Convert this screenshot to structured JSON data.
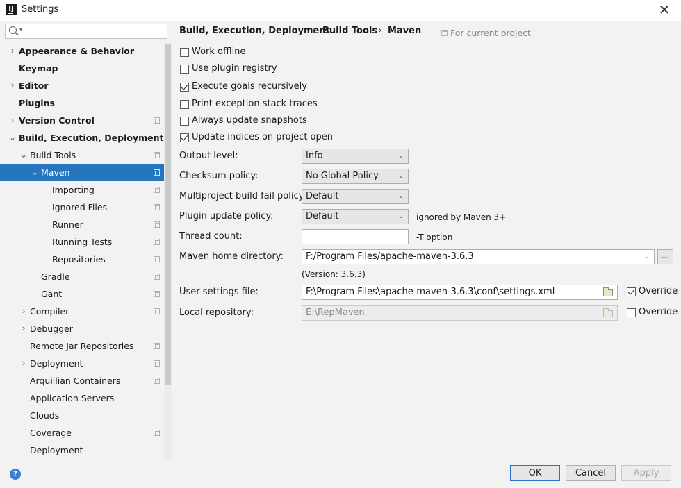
{
  "window": {
    "title": "Settings",
    "app_icon": "IJ"
  },
  "search": {
    "value": "",
    "placeholder": ""
  },
  "tree": [
    {
      "label": "Appearance & Behavior",
      "bold": true,
      "arrow": "›",
      "depth": 0,
      "shared": false
    },
    {
      "label": "Keymap",
      "bold": true,
      "arrow": "",
      "depth": 0,
      "shared": false
    },
    {
      "label": "Editor",
      "bold": true,
      "arrow": "›",
      "depth": 0,
      "shared": false
    },
    {
      "label": "Plugins",
      "bold": true,
      "arrow": "",
      "depth": 0,
      "shared": false
    },
    {
      "label": "Version Control",
      "bold": true,
      "arrow": "›",
      "depth": 0,
      "shared": true
    },
    {
      "label": "Build, Execution, Deployment",
      "bold": true,
      "arrow": "⌄",
      "depth": 0,
      "shared": false
    },
    {
      "label": "Build Tools",
      "bold": false,
      "arrow": "⌄",
      "depth": 1,
      "shared": true
    },
    {
      "label": "Maven",
      "bold": false,
      "arrow": "⌄",
      "depth": 2,
      "shared": true,
      "selected": true
    },
    {
      "label": "Importing",
      "bold": false,
      "arrow": "",
      "depth": 3,
      "shared": true
    },
    {
      "label": "Ignored Files",
      "bold": false,
      "arrow": "",
      "depth": 3,
      "shared": true
    },
    {
      "label": "Runner",
      "bold": false,
      "arrow": "",
      "depth": 3,
      "shared": true
    },
    {
      "label": "Running Tests",
      "bold": false,
      "arrow": "",
      "depth": 3,
      "shared": true
    },
    {
      "label": "Repositories",
      "bold": false,
      "arrow": "",
      "depth": 3,
      "shared": true
    },
    {
      "label": "Gradle",
      "bold": false,
      "arrow": "",
      "depth": 2,
      "shared": true
    },
    {
      "label": "Gant",
      "bold": false,
      "arrow": "",
      "depth": 2,
      "shared": true
    },
    {
      "label": "Compiler",
      "bold": false,
      "arrow": "›",
      "depth": 1,
      "shared": true
    },
    {
      "label": "Debugger",
      "bold": false,
      "arrow": "›",
      "depth": 1,
      "shared": false
    },
    {
      "label": "Remote Jar Repositories",
      "bold": false,
      "arrow": "",
      "depth": 1,
      "shared": true
    },
    {
      "label": "Deployment",
      "bold": false,
      "arrow": "›",
      "depth": 1,
      "shared": true
    },
    {
      "label": "Arquillian Containers",
      "bold": false,
      "arrow": "",
      "depth": 1,
      "shared": true
    },
    {
      "label": "Application Servers",
      "bold": false,
      "arrow": "",
      "depth": 1,
      "shared": false
    },
    {
      "label": "Clouds",
      "bold": false,
      "arrow": "",
      "depth": 1,
      "shared": false
    },
    {
      "label": "Coverage",
      "bold": false,
      "arrow": "",
      "depth": 1,
      "shared": true
    },
    {
      "label": "Deployment",
      "bold": false,
      "arrow": "",
      "depth": 1,
      "shared": false
    }
  ],
  "breadcrumb": {
    "parts": [
      "Build, Execution, Deployment",
      "Build Tools",
      "Maven"
    ],
    "separator": "›",
    "scope": "For current project"
  },
  "options": [
    {
      "label": "Work offline",
      "checked": false
    },
    {
      "label": "Use plugin registry",
      "checked": false
    },
    {
      "label": "Execute goals recursively",
      "checked": true
    },
    {
      "label": "Print exception stack traces",
      "checked": false
    },
    {
      "label": "Always update snapshots",
      "checked": false
    },
    {
      "label": "Update indices on project open",
      "checked": true
    }
  ],
  "fields": {
    "output_level": {
      "label": "Output level:",
      "value": "Info"
    },
    "checksum_policy": {
      "label": "Checksum policy:",
      "value": "No Global Policy"
    },
    "multiproject_fail": {
      "label": "Multiproject build fail policy:",
      "value": "Default"
    },
    "plugin_update": {
      "label": "Plugin update policy:",
      "value": "Default",
      "note": "ignored by Maven 3+"
    },
    "thread_count": {
      "label": "Thread count:",
      "value": "",
      "note": "-T option"
    },
    "maven_home": {
      "label": "Maven home directory:",
      "value": "F:/Program Files/apache-maven-3.6.3",
      "browse": "...",
      "version": "(Version: 3.6.3)"
    },
    "user_settings": {
      "label": "User settings file:",
      "value": "F:\\Program Files\\apache-maven-3.6.3\\conf\\settings.xml",
      "override_label": "Override",
      "override": true
    },
    "local_repo": {
      "label": "Local repository:",
      "value": "E:\\RepMaven",
      "override_label": "Override",
      "override": false
    }
  },
  "buttons": {
    "ok": "OK",
    "cancel": "Cancel",
    "apply": "Apply",
    "help": "?"
  },
  "colors": {
    "selection": "#2675bf",
    "background": "#f2f2f2"
  }
}
